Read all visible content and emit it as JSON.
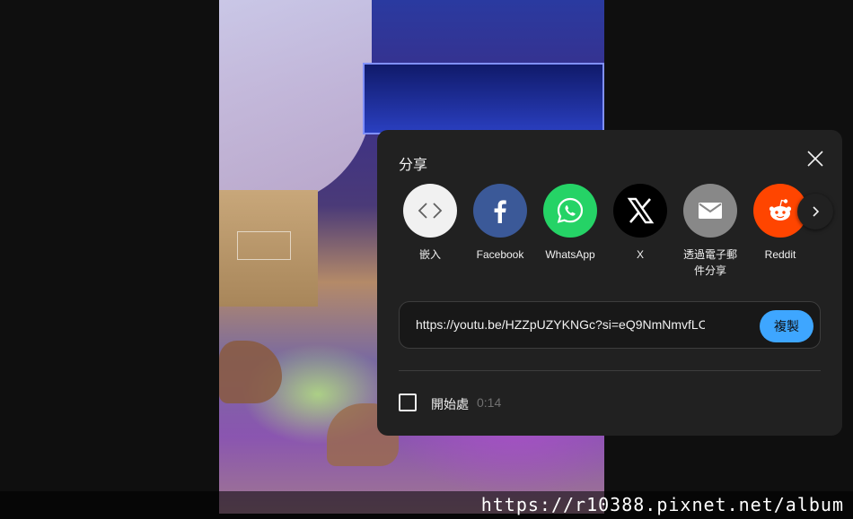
{
  "share_panel": {
    "title": "分享",
    "items": [
      {
        "label": "嵌入",
        "icon": "embed-code-icon",
        "color": "#f1f1f1"
      },
      {
        "label": "Facebook",
        "icon": "facebook-icon",
        "color": "#3b5998"
      },
      {
        "label": "WhatsApp",
        "icon": "whatsapp-icon",
        "color": "#25d366"
      },
      {
        "label": "X",
        "icon": "x-icon",
        "color": "#000000"
      },
      {
        "label": "透過電子郵件分享",
        "icon": "email-icon",
        "color": "#888888"
      },
      {
        "label": "Reddit",
        "icon": "reddit-icon",
        "color": "#ff4500"
      }
    ],
    "url": "https://youtu.be/HZZpUZYKNGc?si=eQ9NmNmvfLC",
    "copy_label": "複製",
    "start_at_label": "開始處",
    "start_at_time": "0:14",
    "start_at_checked": false,
    "accent_color": "#3ea6ff"
  },
  "watermark": {
    "text": "https://r10388.pixnet.net/album"
  }
}
